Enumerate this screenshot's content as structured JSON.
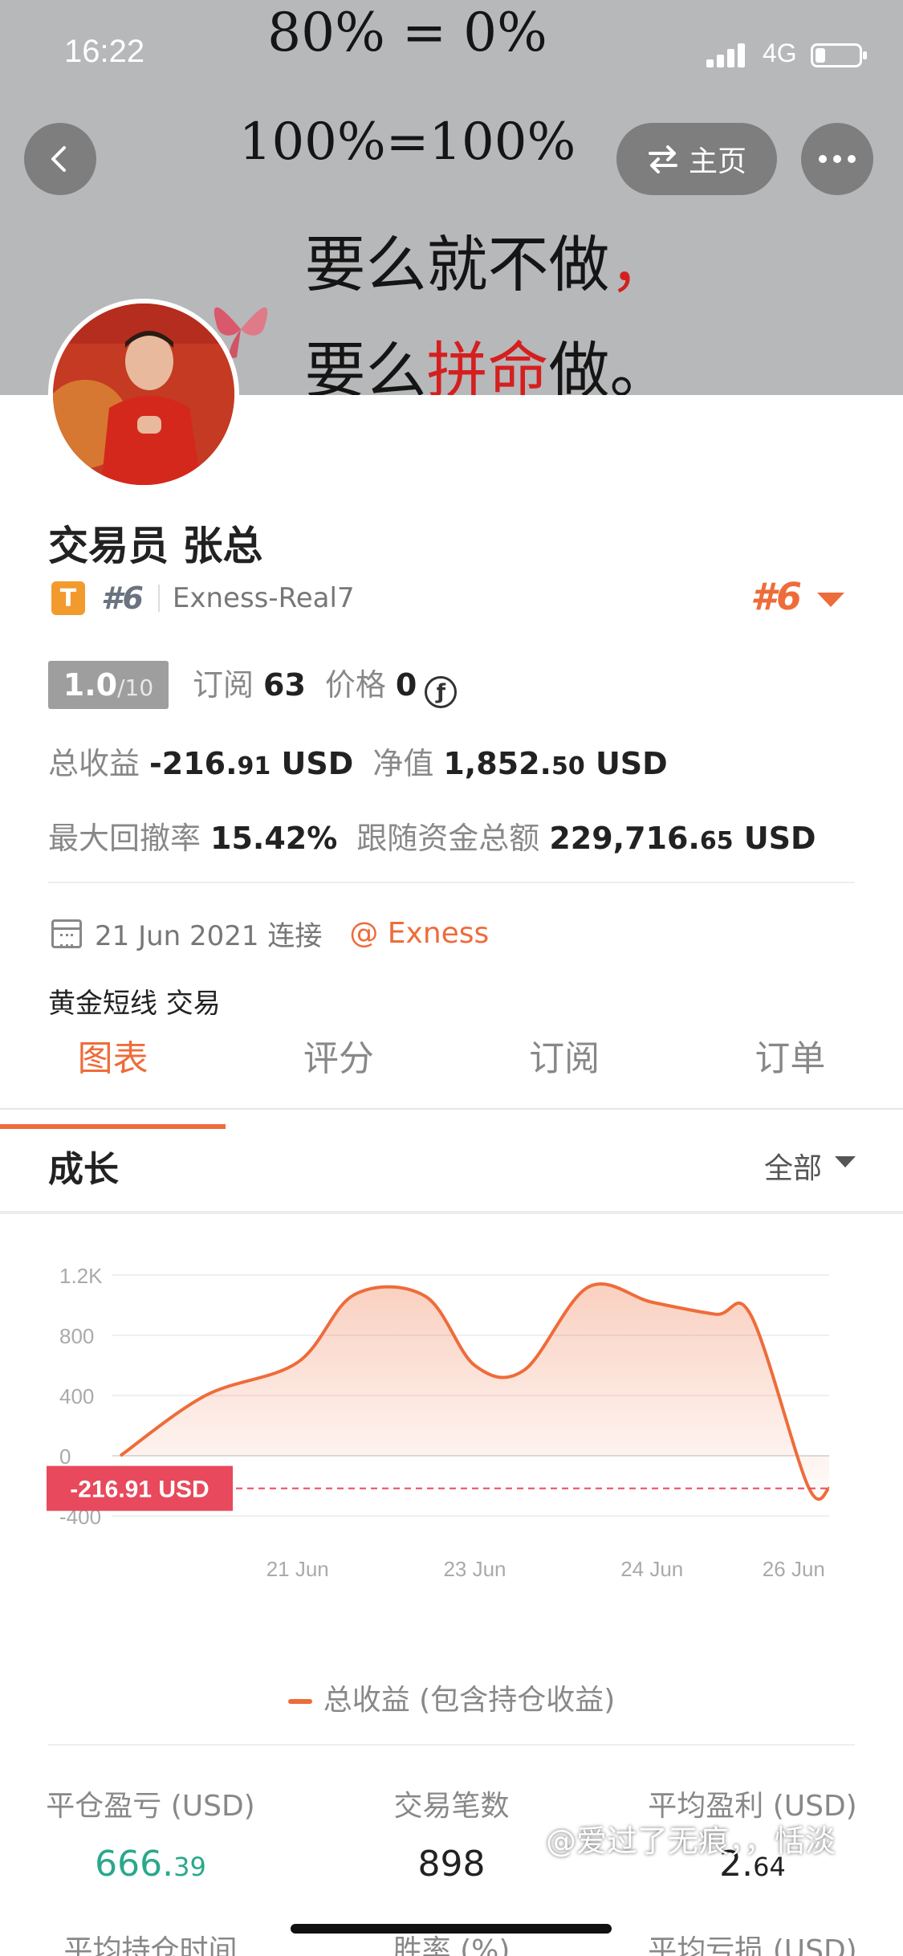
{
  "status_bar": {
    "time": "16:22",
    "network": "4G"
  },
  "banner": {
    "line1": "80% = 0%",
    "line2": "100%=100%",
    "line3_a": "要么就不做",
    "line3_b": "，",
    "line4_a": "要么",
    "line4_b": "拼命",
    "line4_c": "做。"
  },
  "nav": {
    "home_label": "主页",
    "home_icon": "swap-arrows-icon",
    "back_icon": "chevron-left-icon",
    "more_icon": "more-dots-icon"
  },
  "profile": {
    "name": "交易员  张总",
    "badge": "T",
    "rank_small": "#6",
    "account": "Exness-Real7",
    "rank_big": "#6",
    "score": "1.0",
    "score_max": "/10",
    "subscribe_label": "订阅",
    "subscribe_value": "63",
    "price_label": "价格",
    "price_value": "0",
    "total_profit_label": "总收益",
    "total_profit_main": "-216.",
    "total_profit_dec": "91",
    "total_profit_unit": "USD",
    "equity_label": "净值",
    "equity_main": "1,852.",
    "equity_dec": "50",
    "equity_unit": "USD",
    "drawdown_label": "最大回撤率",
    "drawdown_value": "15.42%",
    "follow_label": "跟随资金总额",
    "follow_main": "229,716.",
    "follow_dec": "65",
    "follow_unit": "USD",
    "connect_date": "21 Jun 2021 连接",
    "broker": "@ Exness",
    "description": "黄金短线  交易"
  },
  "tabs": [
    "图表",
    "评分",
    "订阅",
    "订单"
  ],
  "growth": {
    "title": "成长",
    "filter": "全部"
  },
  "chart_data": {
    "type": "area",
    "x": [
      "20 Jun",
      "20 Jun",
      "21 Jun",
      "21 Jun",
      "22 Jun",
      "23 Jun",
      "23 Jun",
      "24 Jun",
      "24 Jun",
      "25 Jun",
      "25 Jun",
      "26 Jun",
      "26 Jun"
    ],
    "x_pos": [
      0,
      0.12,
      0.25,
      0.33,
      0.43,
      0.5,
      0.57,
      0.66,
      0.75,
      0.84,
      0.89,
      0.97,
      1.0
    ],
    "values": [
      0,
      400,
      620,
      1070,
      1060,
      600,
      570,
      1120,
      1020,
      940,
      930,
      -200,
      -216.91
    ],
    "series": [
      {
        "name": "总收益 (包含持仓收益)"
      }
    ],
    "yticks": [
      "1.2K",
      "800",
      "400",
      "0",
      "-400"
    ],
    "ytick_values": [
      1200,
      800,
      400,
      0,
      -400
    ],
    "xticks": [
      "21 Jun",
      "23 Jun",
      "24 Jun",
      "26 Jun"
    ],
    "xtick_pos": [
      0.25,
      0.5,
      0.75,
      0.95
    ],
    "ylim": [
      -400,
      1200
    ],
    "current_label": "-216.91 USD",
    "current_value": -216.91,
    "colors": {
      "line": "#ee6c3a",
      "label_bg": "#e8495c",
      "ref_line": "#e8495c"
    }
  },
  "summary": [
    {
      "label": "平仓盈亏 (USD)",
      "main": "666.",
      "dec": "39"
    },
    {
      "label": "交易笔数",
      "main": "898",
      "dec": ""
    },
    {
      "label": "平均盈利 (USD)",
      "main": "2.",
      "dec": "64"
    }
  ],
  "summary2": [
    {
      "label": "平均持仓时间"
    },
    {
      "label": "胜率 (%)"
    },
    {
      "label": "平均亏损 (USD)"
    }
  ],
  "watermark": "@爱过了无痕，，恬淡"
}
